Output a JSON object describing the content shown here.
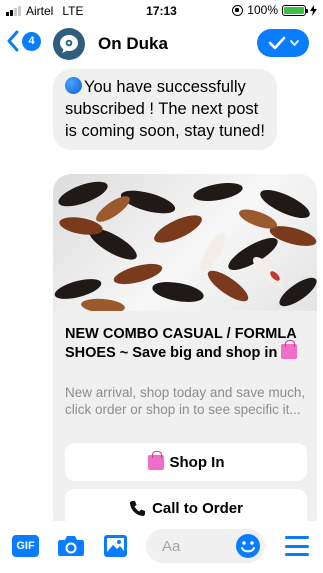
{
  "status_bar": {
    "carrier": "Airtel",
    "network": "LTE",
    "time": "17:13",
    "battery": "100%",
    "signal_bars": 2
  },
  "header": {
    "back_count": "4",
    "title": "On Duka"
  },
  "messages": {
    "subscription_text": "You have successfully subscribed ! The next post is coming soon, stay tuned!"
  },
  "card": {
    "title": "NEW COMBO CASUAL / FORMLA SHOES ~ Save big and shop in",
    "subtitle": "New arrival, shop today and save much, click order or shop in to see specific it...",
    "buttons": {
      "shop_in": "Shop In",
      "call_to_order": "Call to Order"
    }
  },
  "composer": {
    "gif_label": "GIF",
    "placeholder": "Aa"
  },
  "colors": {
    "accent": "#0a7cff",
    "bubble": "#f0f0f0",
    "battery": "#3bc14a"
  }
}
